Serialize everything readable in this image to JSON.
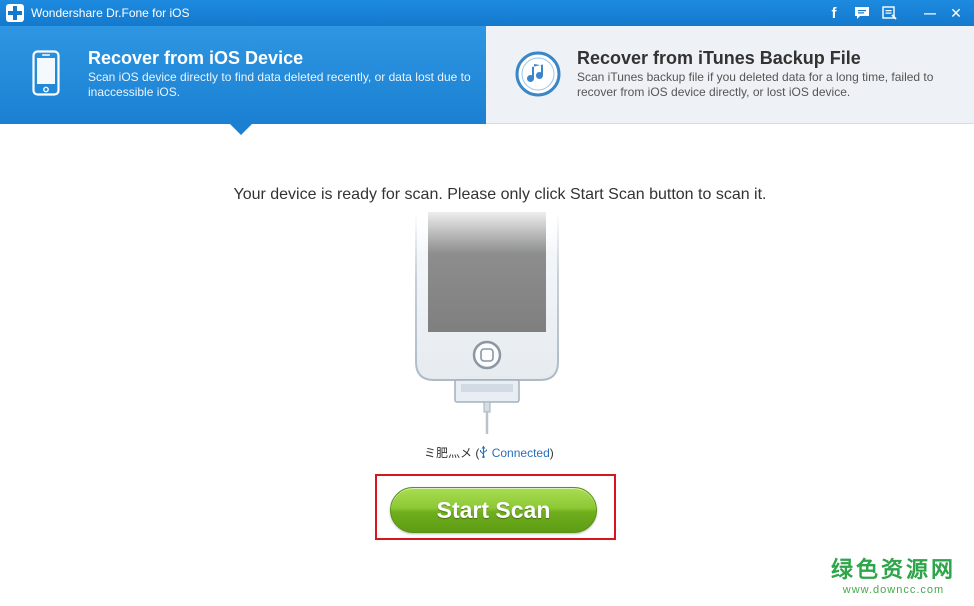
{
  "window": {
    "title": "Wondershare Dr.Fone for iOS"
  },
  "title_bar": {
    "icons": [
      "facebook-icon",
      "feedback-icon",
      "register-icon",
      "minimize-icon",
      "close-icon"
    ],
    "facebook_glyph": "f",
    "minimize_glyph": "—",
    "close_glyph": "✕"
  },
  "tabs": [
    {
      "title": "Recover from iOS Device",
      "description": "Scan iOS device directly to find data deleted recently, or data lost due to inaccessible iOS.",
      "icon": "iphone-icon",
      "active": true
    },
    {
      "title": "Recover from iTunes Backup File",
      "description": "Scan iTunes backup file if you deleted data for a long time, failed to recover from iOS device directly, or lost iOS device.",
      "icon": "itunes-icon",
      "active": false
    }
  ],
  "main": {
    "ready_message": "Your device is ready for scan. Please only click Start Scan button to scan it.",
    "device_name": "ミ肥灬メ",
    "connection_status": "Connected",
    "start_scan_label": "Start Scan"
  },
  "watermark": {
    "text": "绿色资源网",
    "url": "www.downcc.com"
  },
  "colors": {
    "titlebar": "#1479cc",
    "active_tab": "#1b80d2",
    "inactive_tab": "#eef1f5",
    "scan_button": "#7ebd2a",
    "highlight_box": "#d8151d",
    "watermark": "#2ea54a"
  }
}
